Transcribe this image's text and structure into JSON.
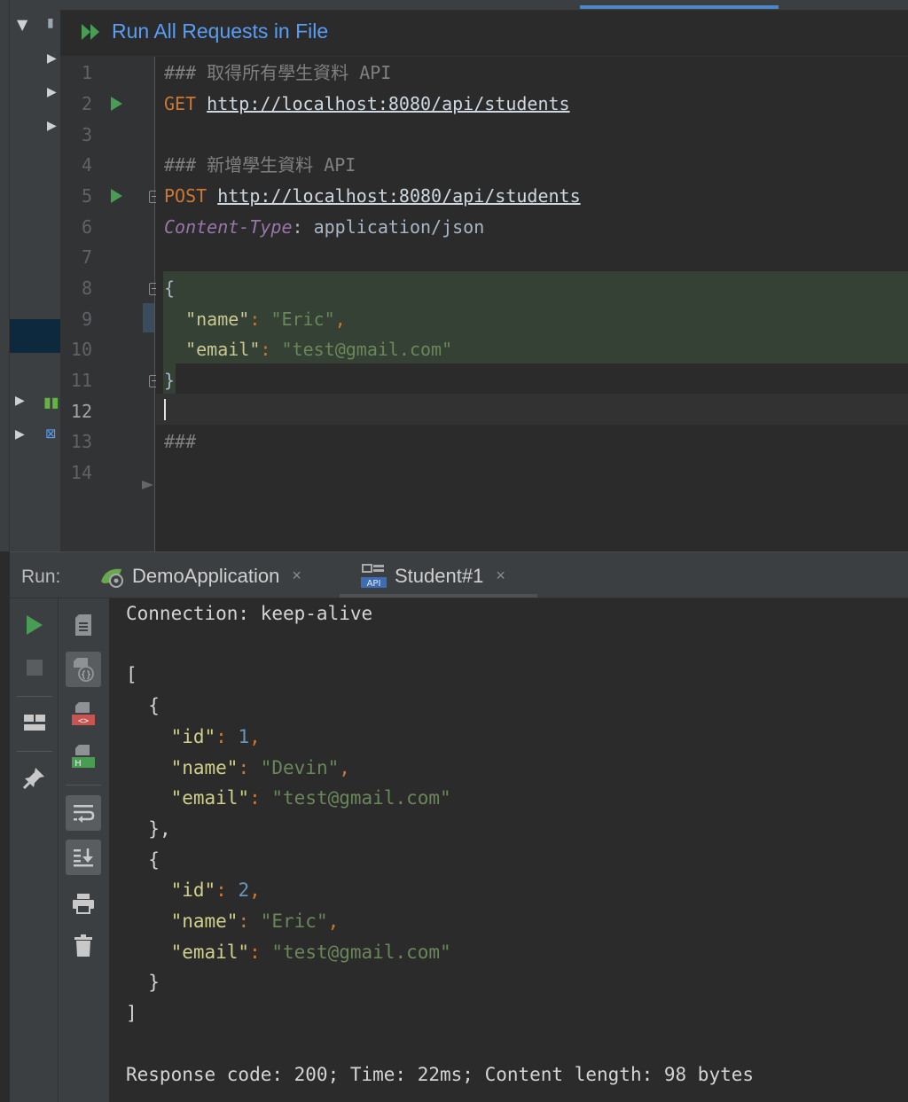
{
  "toolbar": {
    "run_all_label": "Run All Requests in File"
  },
  "editor": {
    "lines": [
      {
        "n": "1",
        "comment": "### 取得所有學生資料 API"
      },
      {
        "n": "2",
        "method": "GET",
        "url": "http://localhost:8080/api/students"
      },
      {
        "n": "3"
      },
      {
        "n": "4",
        "comment": "### 新增學生資料 API"
      },
      {
        "n": "5",
        "method": "POST",
        "url": "http://localhost:8080/api/students"
      },
      {
        "n": "6",
        "header_key": "Content-Type",
        "header_sep": ": ",
        "header_val": "application/json"
      },
      {
        "n": "7"
      },
      {
        "n": "8",
        "text": "{"
      },
      {
        "n": "9",
        "key": "\"name\"",
        "colon": ": ",
        "val": "\"Eric\"",
        "comma": ","
      },
      {
        "n": "10",
        "key": "\"email\"",
        "colon": ": ",
        "val": "\"test@gmail.com\""
      },
      {
        "n": "11",
        "text": "}"
      },
      {
        "n": "12"
      },
      {
        "n": "13",
        "comment": "###"
      },
      {
        "n": "14"
      }
    ],
    "current_line": "12"
  },
  "run_panel": {
    "label": "Run:",
    "tabs": [
      {
        "label": "DemoApplication",
        "close": "×"
      },
      {
        "label": "Student#1",
        "close": "×",
        "active": true
      }
    ]
  },
  "console": {
    "header_line": "Connection: keep-alive",
    "open_bracket": "[",
    "close_bracket": "]",
    "open_brace": "{",
    "close_brace": "}",
    "close_brace_comma": "},",
    "records": [
      {
        "id": "1",
        "name": "\"Devin\"",
        "email": "\"test@gmail.com\""
      },
      {
        "id": "2",
        "name": "\"Eric\"",
        "email": "\"test@gmail.com\""
      }
    ],
    "keys": {
      "id": "\"id\"",
      "name": "\"name\"",
      "email": "\"email\""
    },
    "colon": ": ",
    "comma": ",",
    "status_line": "Response code: 200; Time: 22ms; Content length: 98 bytes"
  },
  "colors": {
    "run_all": "#589df6",
    "run_green": "#499c54",
    "method": "#cc7832",
    "string": "#6a8759",
    "number": "#6897bb",
    "header_key": "#9876aa",
    "comment": "#808080",
    "selected_request_bg": "#344134"
  },
  "icons": [
    "run-all-icon",
    "run-request-icon",
    "fold-icon",
    "rerun-icon",
    "stop-icon",
    "layout-icon",
    "pin-icon",
    "response-file-icon",
    "json-view-icon",
    "html-view-icon",
    "xml-view-icon",
    "soft-wrap-icon",
    "scroll-to-end-icon",
    "print-icon",
    "trash-icon",
    "spring-boot-icon",
    "api-icon"
  ]
}
